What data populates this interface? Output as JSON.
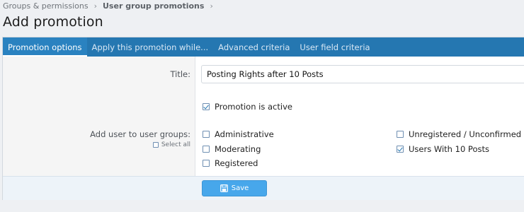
{
  "breadcrumb": {
    "items": [
      "Groups & permissions",
      "User group promotions"
    ],
    "separator": "›"
  },
  "page": {
    "title": "Add promotion"
  },
  "tabs": [
    {
      "label": "Promotion options",
      "active": true
    },
    {
      "label": "Apply this promotion while...",
      "active": false
    },
    {
      "label": "Advanced criteria",
      "active": false
    },
    {
      "label": "User field criteria",
      "active": false
    }
  ],
  "form": {
    "title_label": "Title:",
    "title_value": "Posting Rights after 10 Posts",
    "active_label": "Promotion is active",
    "active_checked": true,
    "groups_label": "Add user to user groups:",
    "select_all_label": "Select all",
    "groups": [
      {
        "label": "Administrative",
        "checked": false
      },
      {
        "label": "Moderating",
        "checked": false
      },
      {
        "label": "Registered",
        "checked": false
      },
      {
        "label": "Unregistered / Unconfirmed",
        "checked": false
      },
      {
        "label": "Users With 10 Posts",
        "checked": true
      }
    ]
  },
  "actions": {
    "save_label": "Save",
    "save_icon": "save-icon"
  },
  "colors": {
    "accent": "#2577b1",
    "button": "#47a7eb",
    "label_bg": "#f5f5f5"
  }
}
